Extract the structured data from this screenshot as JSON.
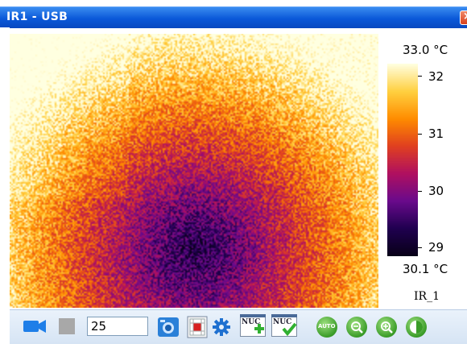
{
  "window": {
    "title": "IR1 - USB"
  },
  "colorbar": {
    "max_label": "33.0 °C",
    "min_label": "30.1 °C",
    "ticks": [
      {
        "value": 32,
        "label": "32"
      },
      {
        "value": 31,
        "label": "31"
      },
      {
        "value": 30,
        "label": "30"
      },
      {
        "value": 29,
        "label": "29"
      }
    ],
    "range": [
      28.9,
      32.3
    ],
    "palette": [
      "#ffffe0",
      "#ffd040",
      "#ff8c00",
      "#e04020",
      "#b01060",
      "#6a0a8c",
      "#200050",
      "#080018"
    ],
    "channel_label": "IR_1"
  },
  "toolbar": {
    "frame_count_value": "25",
    "buttons": [
      {
        "name": "record-video-button",
        "icon": "video-camera-icon"
      },
      {
        "name": "stop-button",
        "icon": "stop-icon"
      },
      {
        "name": "snapshot-button",
        "icon": "camera-icon"
      },
      {
        "name": "palette-button",
        "icon": "palette-icon"
      },
      {
        "name": "settings-button",
        "icon": "gear-icon"
      },
      {
        "name": "nuc-add-button",
        "icon": "nuc-add-icon",
        "label": "NUC"
      },
      {
        "name": "nuc-apply-button",
        "icon": "nuc-check-icon",
        "label": "NUC"
      },
      {
        "name": "auto-button",
        "icon": "auto-icon",
        "label": "AUTO"
      },
      {
        "name": "zoom-out-button",
        "icon": "zoom-out-icon"
      },
      {
        "name": "zoom-in-button",
        "icon": "zoom-in-icon"
      },
      {
        "name": "contrast-button",
        "icon": "contrast-icon"
      }
    ]
  }
}
